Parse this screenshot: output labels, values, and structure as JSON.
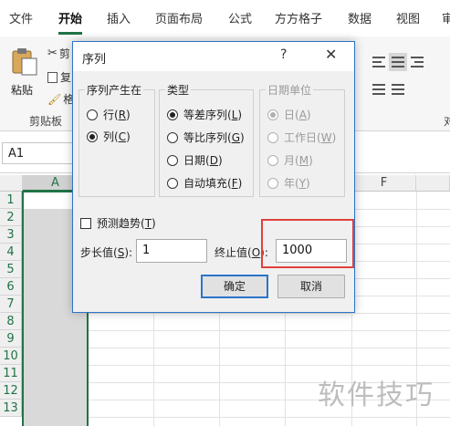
{
  "ribbon": {
    "tabs": [
      "文件",
      "开始",
      "插入",
      "页面布局",
      "公式",
      "方方格子",
      "数据",
      "视图",
      "审"
    ],
    "active_tab": "开始",
    "paste_label": "粘贴",
    "cut_label": "剪",
    "copy_label": "复",
    "format_painter_label": "格",
    "clipboard_group_label": "剪贴板",
    "alignment_group_label_partial": "对"
  },
  "formula_bar": {
    "name_box": "A1"
  },
  "sheet": {
    "columns": [
      "A",
      "F"
    ],
    "rows": [
      "1",
      "2",
      "3",
      "4",
      "5",
      "6",
      "7",
      "8",
      "9",
      "10",
      "11",
      "12",
      "13"
    ]
  },
  "dialog": {
    "title": "序列",
    "help_glyph": "?",
    "close_glyph": "✕",
    "series_in": {
      "legend": "序列产生在",
      "options": [
        {
          "label": "行",
          "key": "R",
          "selected": false
        },
        {
          "label": "列",
          "key": "C",
          "selected": true
        }
      ]
    },
    "type": {
      "legend": "类型",
      "options": [
        {
          "label": "等差序列",
          "key": "L",
          "selected": true
        },
        {
          "label": "等比序列",
          "key": "G",
          "selected": false
        },
        {
          "label": "日期",
          "key": "D",
          "selected": false
        },
        {
          "label": "自动填充",
          "key": "F",
          "selected": false
        }
      ]
    },
    "date_unit": {
      "legend": "日期单位",
      "options": [
        {
          "label": "日",
          "key": "A",
          "selected": true
        },
        {
          "label": "工作日",
          "key": "W",
          "selected": false
        },
        {
          "label": "月",
          "key": "M",
          "selected": false
        },
        {
          "label": "年",
          "key": "Y",
          "selected": false
        }
      ]
    },
    "trend": {
      "label": "预测趋势",
      "key": "T",
      "checked": false
    },
    "step": {
      "label": "步长值",
      "key": "S",
      "value": "1"
    },
    "stop": {
      "label": "终止值",
      "key": "O",
      "value": "1000"
    },
    "ok_label": "确定",
    "cancel_label": "取消"
  },
  "watermark": "软件技巧",
  "colors": {
    "excel_green": "#217346",
    "dialog_border": "#2b74c8",
    "highlight_red": "#e0403d"
  }
}
